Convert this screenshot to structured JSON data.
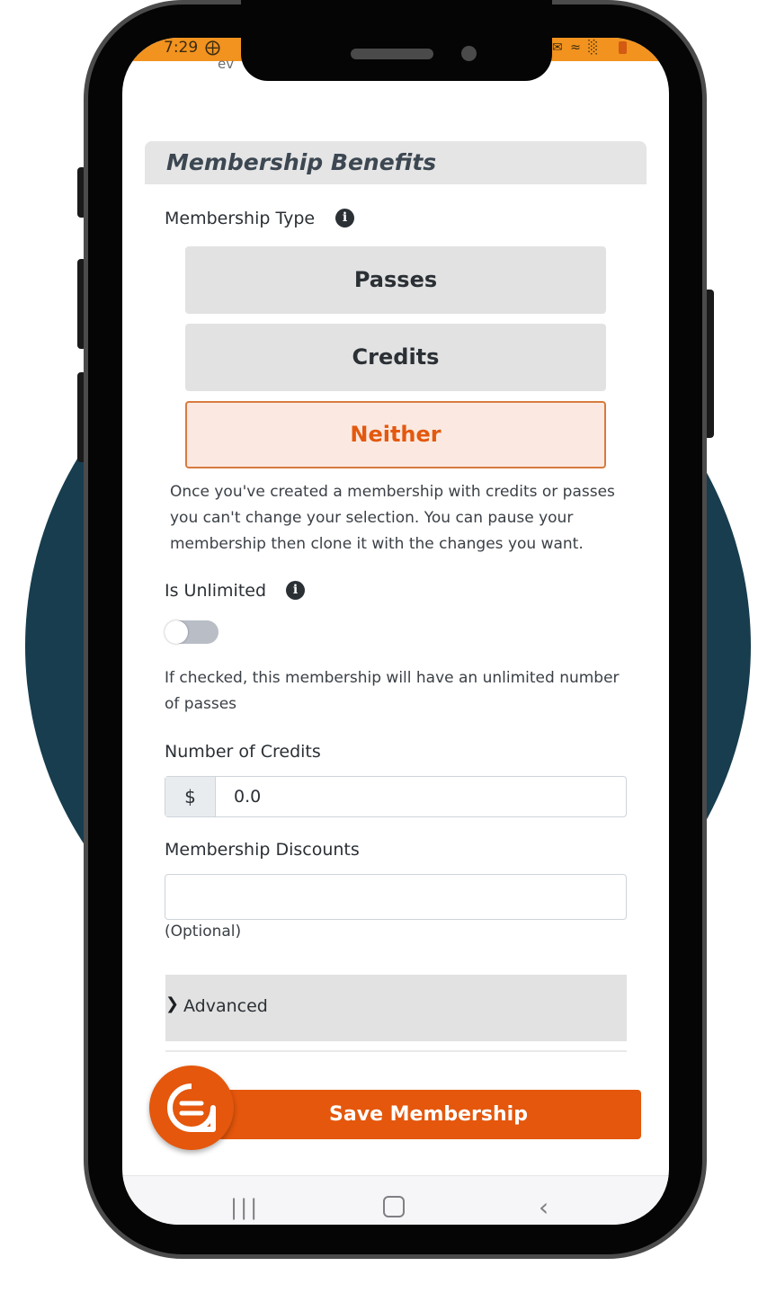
{
  "status_bar": {
    "time": "7:29",
    "slack_icon": "slack-icon",
    "truncated_text": "ev"
  },
  "section": {
    "title": "Membership Benefits"
  },
  "membership_type": {
    "label": "Membership Type",
    "options": [
      {
        "label": "Passes",
        "selected": false
      },
      {
        "label": "Credits",
        "selected": false
      },
      {
        "label": "Neither",
        "selected": true
      }
    ],
    "help_lines": [
      "Once you've created a membership with credits or passes",
      "you can't change your selection. You can pause your",
      "membership then clone it with the changes you want."
    ]
  },
  "unlimited": {
    "label": "Is Unlimited",
    "checked": false,
    "help_lines": [
      "If checked, this membership will have an unlimited number",
      "of passes"
    ]
  },
  "credits": {
    "label": "Number of Credits",
    "prefix": "$",
    "value": "0.0"
  },
  "discounts": {
    "label": "Membership Discounts",
    "value": "",
    "hint": "(Optional)"
  },
  "advanced": {
    "label": "Advanced"
  },
  "save": {
    "label": "Save Membership"
  },
  "colors": {
    "accent": "#e4570c",
    "status_bar": "#f2931f",
    "selected_bg": "#fbe9e1",
    "bg_circle": "#173d4e"
  },
  "nav": {
    "recent": "recent-apps-icon",
    "home": "home-icon",
    "back": "back-icon"
  }
}
